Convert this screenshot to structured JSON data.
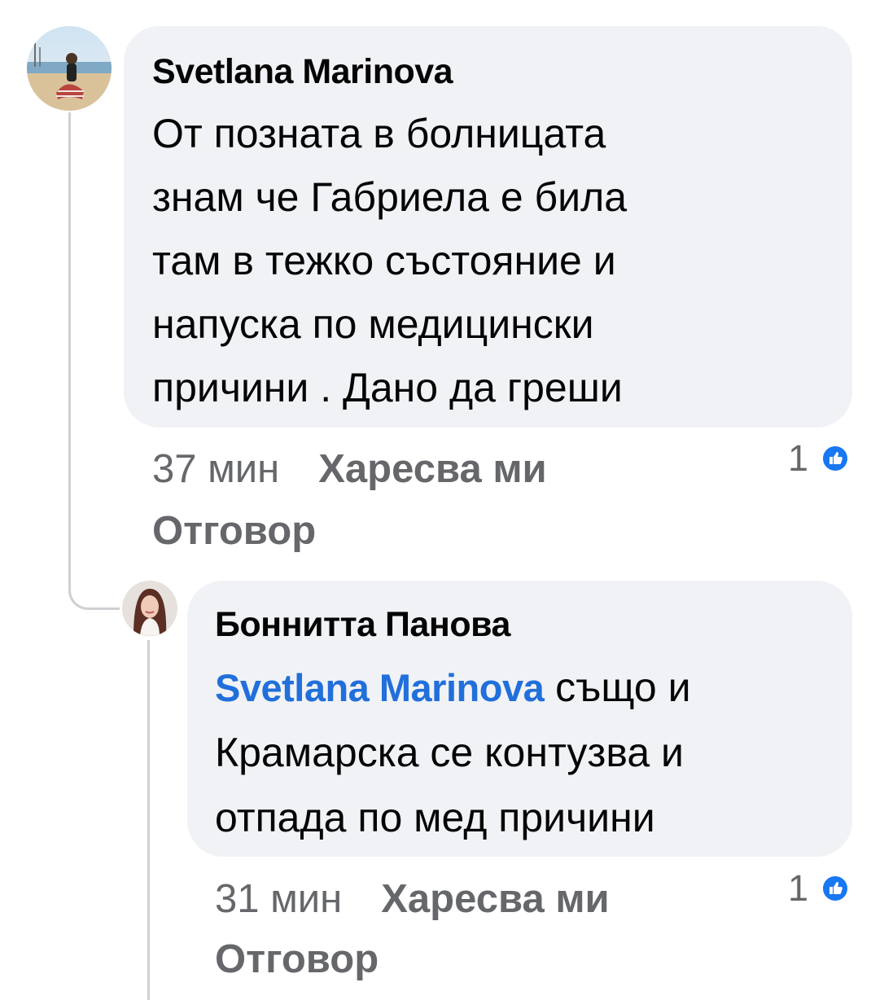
{
  "colors": {
    "bubble": "#f0f2f5",
    "meta": "#65676b",
    "mention": "#216fdb",
    "like_badge": "#1877f2",
    "thread": "#ced0d4"
  },
  "comments": [
    {
      "author": "Svetlana Marinova",
      "avatar_icon": "user-avatar-photo",
      "lines": [
        "От позната в болницата",
        "знам че Габриела е била",
        "там в тежко състояние и",
        "напуска по медицински",
        "причини . Дано да греши"
      ],
      "time": "37 мин",
      "like_label": "Харесва ми",
      "reply_label": "Отговор",
      "reaction_count": "1",
      "reaction_icon": "like-icon"
    },
    {
      "author": "Боннитта Панова",
      "avatar_icon": "user-avatar-photo",
      "mention": "Svetlana Marinova",
      "first_line_rest": " също и",
      "lines": [
        "Крамарска се контузва и",
        "отпада по мед причини"
      ],
      "time": "31 мин",
      "like_label": "Харесва ми",
      "reply_label": "Отговор",
      "reaction_count": "1",
      "reaction_icon": "like-icon"
    }
  ]
}
